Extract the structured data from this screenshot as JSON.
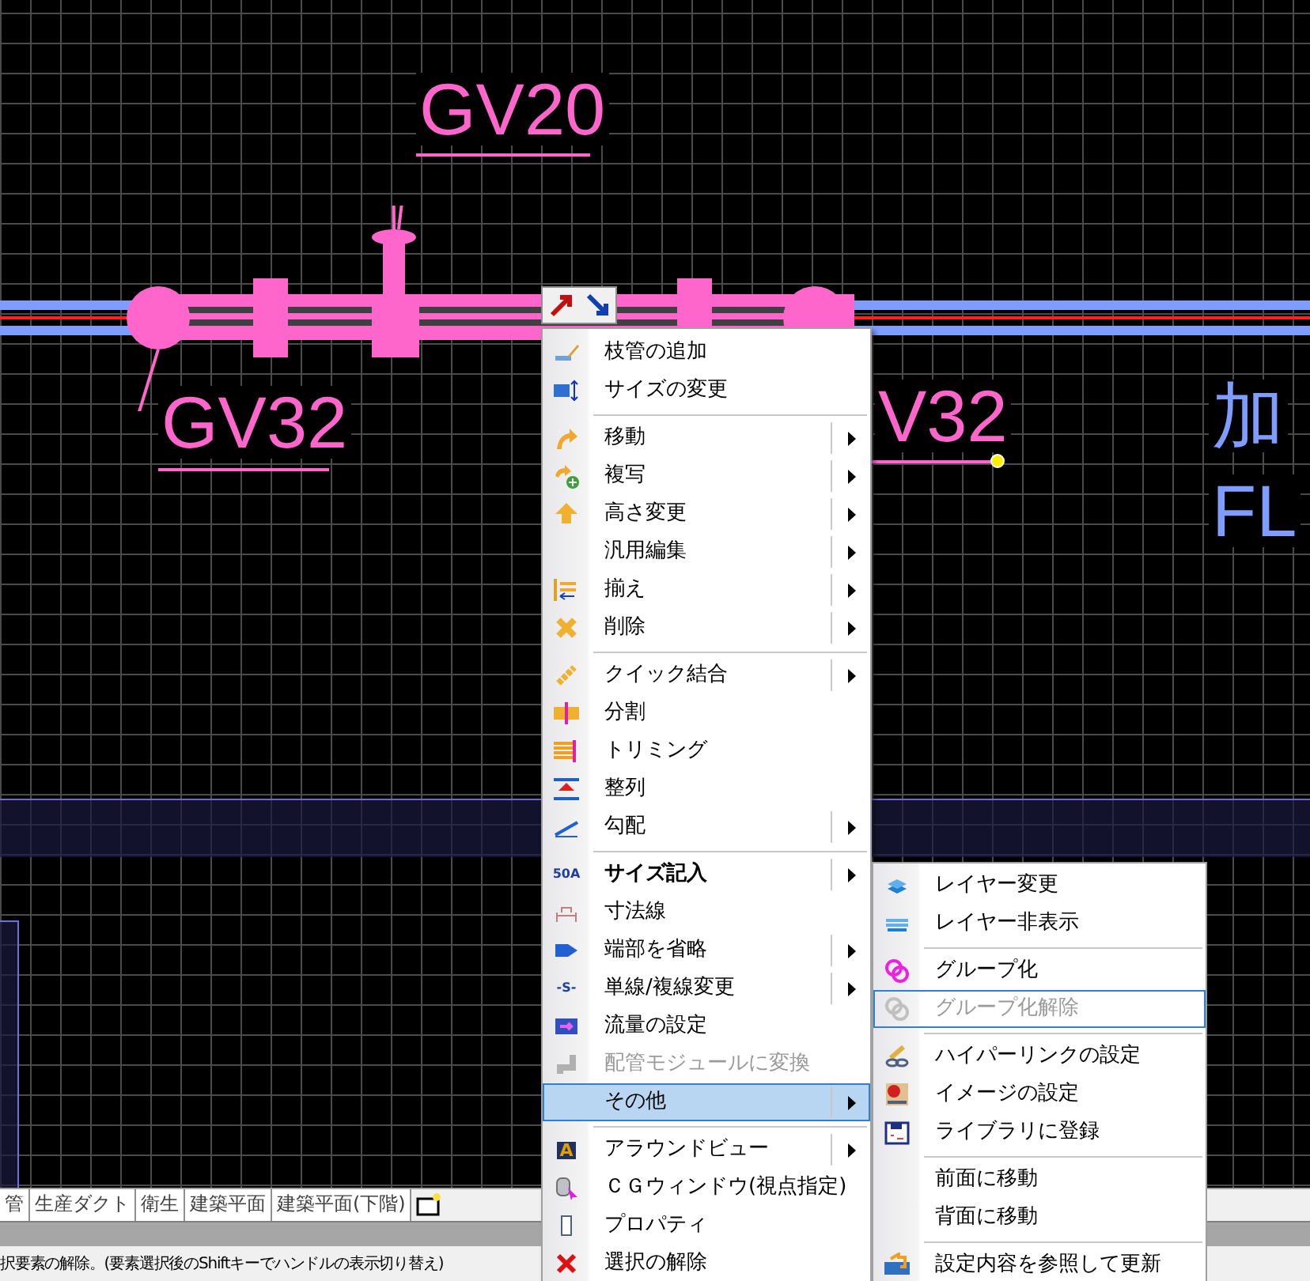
{
  "canvas": {
    "labels": [
      {
        "text": "GV20",
        "color": "#ff66cc"
      },
      {
        "text": "GV32",
        "color": "#ff66cc"
      },
      {
        "text": "V32",
        "color": "#ff66cc"
      },
      {
        "text": "加",
        "color": "#7f9cff"
      },
      {
        "text": "FL",
        "color": "#7f9cff"
      }
    ]
  },
  "context_menu": {
    "items": [
      {
        "kind": "item",
        "label": "枝管の追加",
        "submenu": false,
        "disabled": false,
        "selected": false,
        "default": false
      },
      {
        "kind": "item",
        "label": "サイズの変更",
        "submenu": false,
        "disabled": false,
        "selected": false,
        "default": false
      },
      {
        "kind": "separator"
      },
      {
        "kind": "item",
        "label": "移動",
        "submenu": true,
        "disabled": false,
        "selected": false,
        "default": false
      },
      {
        "kind": "item",
        "label": "複写",
        "submenu": true,
        "disabled": false,
        "selected": false,
        "default": false
      },
      {
        "kind": "item",
        "label": "高さ変更",
        "submenu": true,
        "disabled": false,
        "selected": false,
        "default": false
      },
      {
        "kind": "item",
        "label": "汎用編集",
        "submenu": true,
        "disabled": false,
        "selected": false,
        "default": false
      },
      {
        "kind": "item",
        "label": "揃え",
        "submenu": true,
        "disabled": false,
        "selected": false,
        "default": false
      },
      {
        "kind": "item",
        "label": "削除",
        "submenu": true,
        "disabled": false,
        "selected": false,
        "default": false
      },
      {
        "kind": "separator"
      },
      {
        "kind": "item",
        "label": "クイック結合",
        "submenu": true,
        "disabled": false,
        "selected": false,
        "default": false
      },
      {
        "kind": "item",
        "label": "分割",
        "submenu": false,
        "disabled": false,
        "selected": false,
        "default": false
      },
      {
        "kind": "item",
        "label": "トリミング",
        "submenu": false,
        "disabled": false,
        "selected": false,
        "default": false
      },
      {
        "kind": "item",
        "label": "整列",
        "submenu": false,
        "disabled": false,
        "selected": false,
        "default": false
      },
      {
        "kind": "item",
        "label": "勾配",
        "submenu": true,
        "disabled": false,
        "selected": false,
        "default": false
      },
      {
        "kind": "separator"
      },
      {
        "kind": "item",
        "label": "サイズ記入",
        "icon_text": "50A",
        "submenu": true,
        "disabled": false,
        "selected": false,
        "default": true
      },
      {
        "kind": "item",
        "label": "寸法線",
        "submenu": false,
        "disabled": false,
        "selected": false,
        "default": false
      },
      {
        "kind": "item",
        "label": "端部を省略",
        "submenu": true,
        "disabled": false,
        "selected": false,
        "default": false
      },
      {
        "kind": "item",
        "label": "単線/複線変更",
        "icon_text": "-S-",
        "submenu": true,
        "disabled": false,
        "selected": false,
        "default": false
      },
      {
        "kind": "item",
        "label": "流量の設定",
        "submenu": false,
        "disabled": false,
        "selected": false,
        "default": false
      },
      {
        "kind": "item",
        "label": "配管モジュールに変換",
        "submenu": false,
        "disabled": true,
        "selected": false,
        "default": false
      },
      {
        "kind": "item",
        "label": "その他",
        "submenu": true,
        "disabled": false,
        "selected": true,
        "default": false
      },
      {
        "kind": "separator"
      },
      {
        "kind": "item",
        "label": "アラウンドビュー",
        "icon_text": "A",
        "submenu": true,
        "disabled": false,
        "selected": false,
        "default": false
      },
      {
        "kind": "item",
        "label": "ＣＧウィンドウ(視点指定)",
        "submenu": false,
        "disabled": false,
        "selected": false,
        "default": false
      },
      {
        "kind": "item",
        "label": "プロパティ",
        "submenu": false,
        "disabled": false,
        "selected": false,
        "default": false
      },
      {
        "kind": "item",
        "label": "選択の解除",
        "submenu": false,
        "disabled": false,
        "selected": false,
        "default": false
      }
    ]
  },
  "submenu": {
    "items": [
      {
        "kind": "item",
        "label": "レイヤー変更",
        "disabled": false,
        "selected": false
      },
      {
        "kind": "item",
        "label": "レイヤー非表示",
        "disabled": false,
        "selected": false
      },
      {
        "kind": "separator"
      },
      {
        "kind": "item",
        "label": "グループ化",
        "disabled": false,
        "selected": false
      },
      {
        "kind": "item",
        "label": "グループ化解除",
        "disabled": true,
        "selected": true
      },
      {
        "kind": "separator"
      },
      {
        "kind": "item",
        "label": "ハイパーリンクの設定",
        "disabled": false,
        "selected": false
      },
      {
        "kind": "item",
        "label": "イメージの設定",
        "disabled": false,
        "selected": false
      },
      {
        "kind": "item",
        "label": "ライブラリに登録",
        "disabled": false,
        "selected": false
      },
      {
        "kind": "separator"
      },
      {
        "kind": "item",
        "label": "前面に移動",
        "disabled": false,
        "selected": false
      },
      {
        "kind": "item",
        "label": "背面に移動",
        "disabled": false,
        "selected": false
      },
      {
        "kind": "separator"
      },
      {
        "kind": "item",
        "label": "設定内容を参照して更新",
        "disabled": false,
        "selected": false
      }
    ]
  },
  "sheet_tabs": [
    {
      "label": "管"
    },
    {
      "label": "生産ダクト"
    },
    {
      "label": "衛生"
    },
    {
      "label": "建築平面"
    },
    {
      "label": "建築平面(下階)"
    }
  ],
  "status_bar": {
    "text": "択要素の解除。(要素選択後のShiftキーでハンドルの表示切り替え)"
  }
}
